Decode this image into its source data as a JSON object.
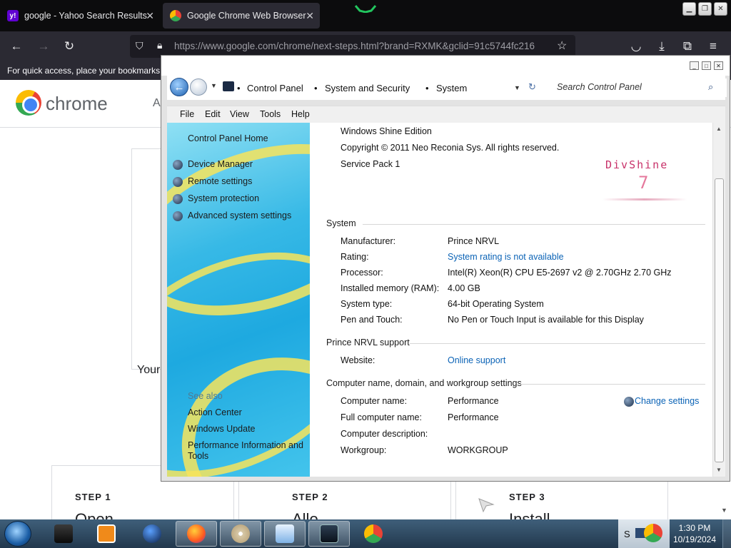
{
  "browser": {
    "tabs": [
      {
        "title": "google - Yahoo Search Results",
        "favicon": "yahoo-icon"
      },
      {
        "title": "Google Chrome Web Browser",
        "favicon": "chrome-icon"
      }
    ],
    "url": "https://www.google.com/chrome/next-steps.html?brand=RXMK&gclid=91c5744fc216",
    "bookmarks_message": "For quick access, place your bookmarks h"
  },
  "webpage": {
    "logo_text": "chrome",
    "nav_fragment": "A",
    "left_fragment": "Your",
    "steps": [
      {
        "label": "STEP 1",
        "heading_fragment": "Open"
      },
      {
        "label": "STEP 2",
        "heading_fragment": "Allo"
      },
      {
        "label": "STEP 3",
        "heading_fragment": "Install"
      }
    ]
  },
  "control_panel": {
    "breadcrumbs": [
      "Control Panel",
      "System and Security",
      "System"
    ],
    "search_placeholder": "Search Control Panel",
    "menu": [
      "File",
      "Edit",
      "View",
      "Tools",
      "Help"
    ],
    "sidebar": {
      "home": "Control Panel Home",
      "tasks": [
        "Device Manager",
        "Remote settings",
        "System protection",
        "Advanced system settings"
      ],
      "see_also_title": "See also",
      "see_also": [
        "Action Center",
        "Windows Update",
        "Performance Information and",
        "Tools"
      ]
    },
    "edition": {
      "name": "Windows Shine Edition",
      "copyright": "Copyright © 2011 Neo Reconia Sys.  All rights reserved.",
      "service_pack": "Service Pack 1",
      "logo_word": "DivShine",
      "logo_number": "7"
    },
    "system": {
      "title": "System",
      "rows": [
        {
          "label": "Manufacturer:",
          "value": "Prince NRVL"
        },
        {
          "label": "Rating:",
          "value": "System rating is not available"
        },
        {
          "label": "Processor:",
          "value": "Intel(R) Xeon(R) CPU E5-2697 v2 @ 2.70GHz   2.70 GHz"
        },
        {
          "label": "Installed memory (RAM):",
          "value": "4.00 GB"
        },
        {
          "label": "System type:",
          "value": "64-bit Operating System"
        },
        {
          "label": "Pen and Touch:",
          "value": "No Pen or Touch Input is available for this Display"
        }
      ]
    },
    "support": {
      "title": "Prince NRVL support",
      "website_label": "Website:",
      "website_value": "Online support"
    },
    "computer": {
      "title": "Computer name, domain, and workgroup settings",
      "change_settings": "Change settings",
      "rows": [
        {
          "label": "Computer name:",
          "value": "Performance"
        },
        {
          "label": "Full computer name:",
          "value": "Performance"
        },
        {
          "label": "Computer description:",
          "value": ""
        },
        {
          "label": "Workgroup:",
          "value": "WORKGROUP"
        }
      ]
    }
  },
  "taskbar": {
    "items": [
      "terminal-icon",
      "media-player-icon",
      "globe-icon",
      "firefox-icon",
      "cd-icon",
      "control-panel-icon",
      "display-icon",
      "chrome-icon"
    ],
    "tray_letter": "S",
    "time": "1:30 PM",
    "date": "10/19/2024"
  },
  "colors": {
    "link": "#0b63b6",
    "firefox_tab_bg": "#2b2a33",
    "taskbar_top": "#3f5f7a"
  }
}
